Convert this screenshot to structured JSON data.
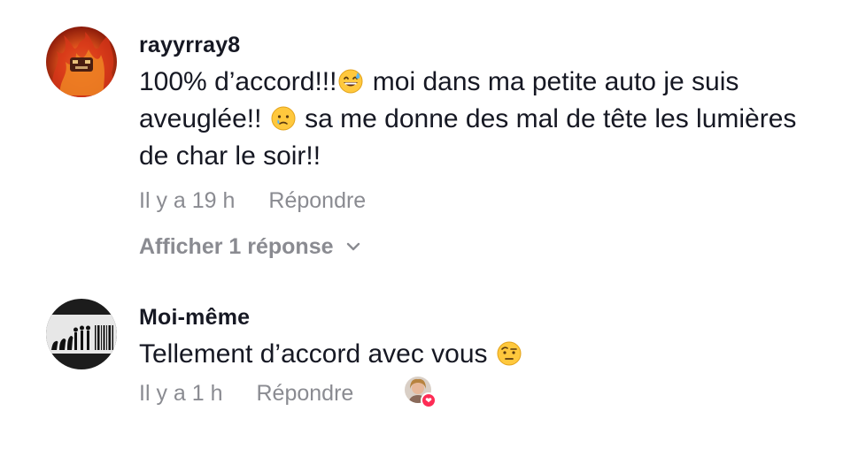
{
  "comments": [
    {
      "username": "rayyrray8",
      "text_part1": "100% d’accord!!!",
      "emoji1": "grinning-sweat-emoji",
      "text_part2": " moi dans ma petite auto je suis aveuglée!! ",
      "emoji2": "crying-face-emoji",
      "text_part3": " sa me donne des mal de tête les lumières de char le soir!!",
      "time": "Il y a 19 h",
      "reply_label": "Répondre",
      "view_replies": "Afficher 1 réponse"
    },
    {
      "username": "Moi-même",
      "text_part1": "Tellement d’accord avec vous ",
      "emoji1": "raised-eyebrow-emoji",
      "time": "Il y a 1 h",
      "reply_label": "Répondre"
    }
  ],
  "colors": {
    "primary_text": "#161823",
    "secondary_text": "#8a8b91",
    "like_accent": "#fe2c55"
  }
}
